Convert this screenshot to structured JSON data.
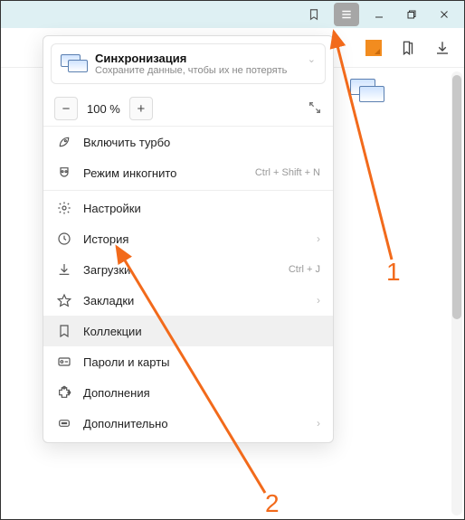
{
  "titlebar": {
    "bookmark_icon": "bookmark",
    "menu_icon": "hamburger",
    "minimize": "–",
    "maximize": "❐",
    "close": "✕"
  },
  "toolbar": {
    "app_icon": "orange-square",
    "collections_icon": "collections",
    "download_icon": "download"
  },
  "sync": {
    "title": "Синхронизация",
    "subtitle": "Сохраните данные, чтобы их не потерять"
  },
  "zoom": {
    "minus": "−",
    "value": "100 %",
    "plus": "+"
  },
  "menu": {
    "turbo": "Включить турбо",
    "incognito": "Режим инкогнито",
    "incognito_shortcut": "Ctrl + Shift + N",
    "settings": "Настройки",
    "history": "История",
    "downloads": "Загрузки",
    "downloads_shortcut": "Ctrl + J",
    "bookmarks": "Закладки",
    "collections": "Коллекции",
    "passwords": "Пароли и карты",
    "addons": "Дополнения",
    "more": "Дополнительно"
  },
  "annotations": {
    "n1": "1",
    "n2": "2"
  }
}
